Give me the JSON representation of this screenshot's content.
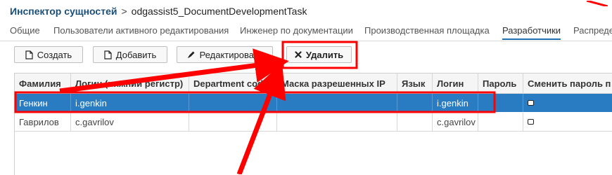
{
  "breadcrumb": {
    "root": "Инспектор сущностей",
    "separator": ">",
    "leaf": "odgassist5_DocumentDevelopmentTask"
  },
  "tabs": [
    {
      "label": "Общие"
    },
    {
      "label": "Пользователи активного редактирования"
    },
    {
      "label": "Инженер по документации"
    },
    {
      "label": "Производственная площадка"
    },
    {
      "label": "Разработчики",
      "active": true
    },
    {
      "label": "Распреде"
    }
  ],
  "toolbar": {
    "create_label": "Создать",
    "add_label": "Добавить",
    "edit_label": "Редактировать",
    "delete_label": "Удалить"
  },
  "grid": {
    "columns": [
      "Фамилия",
      "Логин (нижний регистр)",
      "Department code",
      "Маска разрешенных IP",
      "Язык",
      "Логин",
      "Пароль",
      "Сменить пароль п"
    ],
    "rows": [
      {
        "lastname": "Генкин",
        "login_lower": "i.genkin",
        "department_code": "",
        "ip_mask": "",
        "language": "",
        "login": "i.genkin",
        "password": "",
        "change_password": false,
        "selected": true
      },
      {
        "lastname": "Гаврилов",
        "login_lower": "c.gavrilov",
        "department_code": "",
        "ip_mask": "",
        "language": "",
        "login": "c.gavrilov",
        "password": "",
        "change_password": false,
        "selected": false
      }
    ]
  },
  "colors": {
    "accent": "#1e6fb5",
    "selected_row": "#2a7cc2",
    "annotation": "#ff0000"
  }
}
